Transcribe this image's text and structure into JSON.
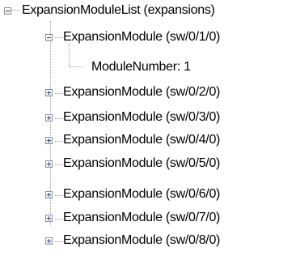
{
  "tree": {
    "root": {
      "label": "ExpansionModuleList (expansions)",
      "state": "expanded"
    },
    "children": [
      {
        "label": "ExpansionModule (sw/0/1/0)",
        "state": "expanded",
        "children": [
          {
            "label": "ModuleNumber: 1"
          }
        ]
      },
      {
        "label": "ExpansionModule (sw/0/2/0)",
        "state": "collapsed"
      },
      {
        "label": "ExpansionModule (sw/0/3/0)",
        "state": "collapsed"
      },
      {
        "label": "ExpansionModule (sw/0/4/0)",
        "state": "collapsed"
      },
      {
        "label": "ExpansionModule (sw/0/5/0)",
        "state": "collapsed"
      },
      {
        "label": "ExpansionModule (sw/0/6/0)",
        "state": "collapsed"
      },
      {
        "label": "ExpansionModule (sw/0/7/0)",
        "state": "collapsed"
      },
      {
        "label": "ExpansionModule (sw/0/8/0)",
        "state": "collapsed"
      }
    ],
    "icons": {
      "expanded": "collapse-minus-icon",
      "collapsed": "expand-plus-icon"
    }
  }
}
